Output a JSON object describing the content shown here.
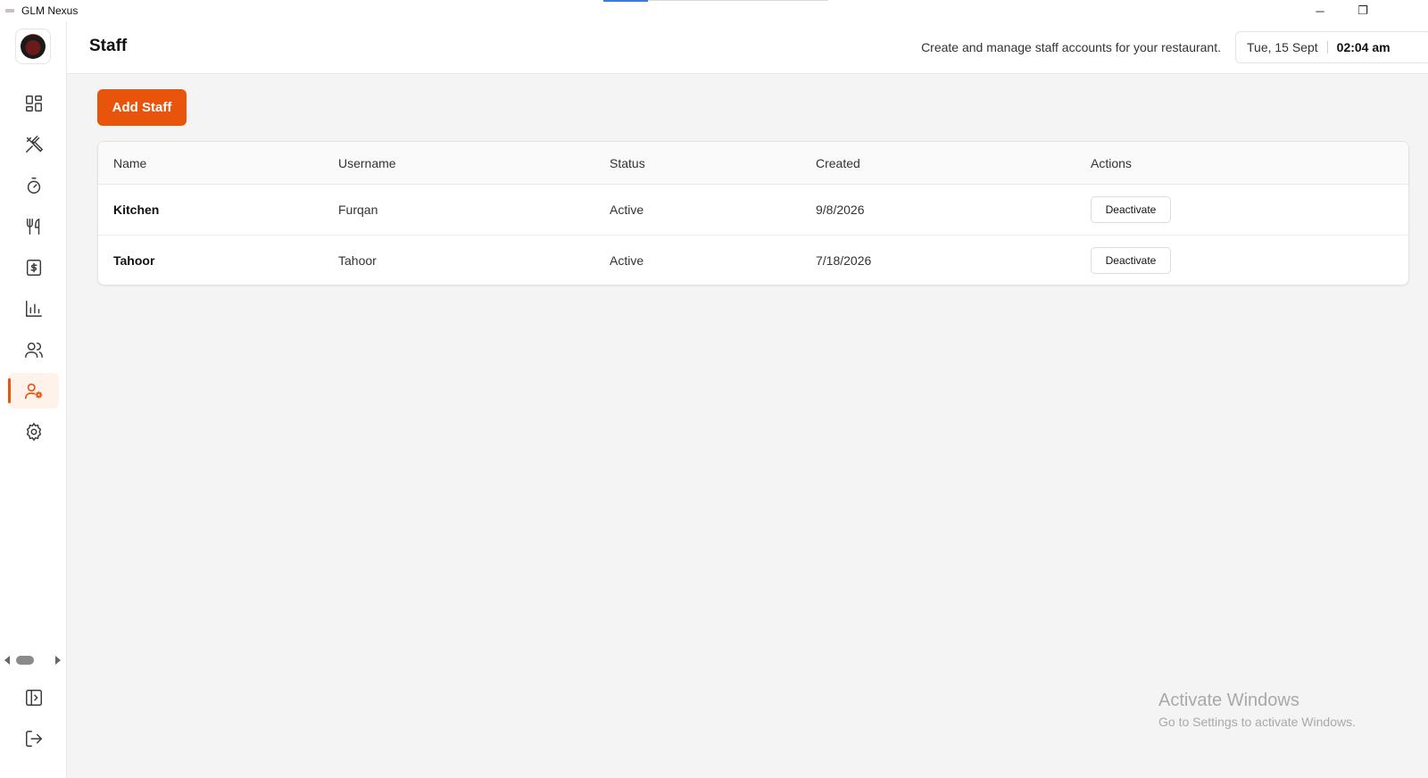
{
  "window": {
    "title": "GLM Nexus",
    "minimize_glyph": "─",
    "restore_glyph": "❐"
  },
  "header": {
    "title": "Staff",
    "description": "Create and manage staff accounts for your restaurant.",
    "date": "Tue, 15 Sept",
    "time": "02:04 am"
  },
  "sidebar": {
    "items": [
      {
        "icon": "dashboard-icon"
      },
      {
        "icon": "utensils-crossed-icon"
      },
      {
        "icon": "timer-icon"
      },
      {
        "icon": "fork-knife-icon"
      },
      {
        "icon": "dollar-receipt-icon"
      },
      {
        "icon": "bar-chart-icon"
      },
      {
        "icon": "users-icon"
      },
      {
        "icon": "user-cog-icon",
        "active": true
      },
      {
        "icon": "settings-gear-icon"
      }
    ],
    "bottom": [
      {
        "icon": "sidebar-expand-icon"
      },
      {
        "icon": "logout-icon"
      }
    ],
    "accent_color": "#e8540c"
  },
  "main": {
    "add_button_label": "Add Staff",
    "table": {
      "columns": [
        "Name",
        "Username",
        "Status",
        "Created",
        "Actions"
      ],
      "rows": [
        {
          "name": "Kitchen",
          "username": "Furqan",
          "status": "Active",
          "created": "9/8/2026",
          "action": "Deactivate"
        },
        {
          "name": "Tahoor",
          "username": "Tahoor",
          "status": "Active",
          "created": "7/18/2026",
          "action": "Deactivate"
        }
      ]
    }
  },
  "watermark": {
    "line1": "Activate Windows",
    "line2": "Go to Settings to activate Windows."
  }
}
